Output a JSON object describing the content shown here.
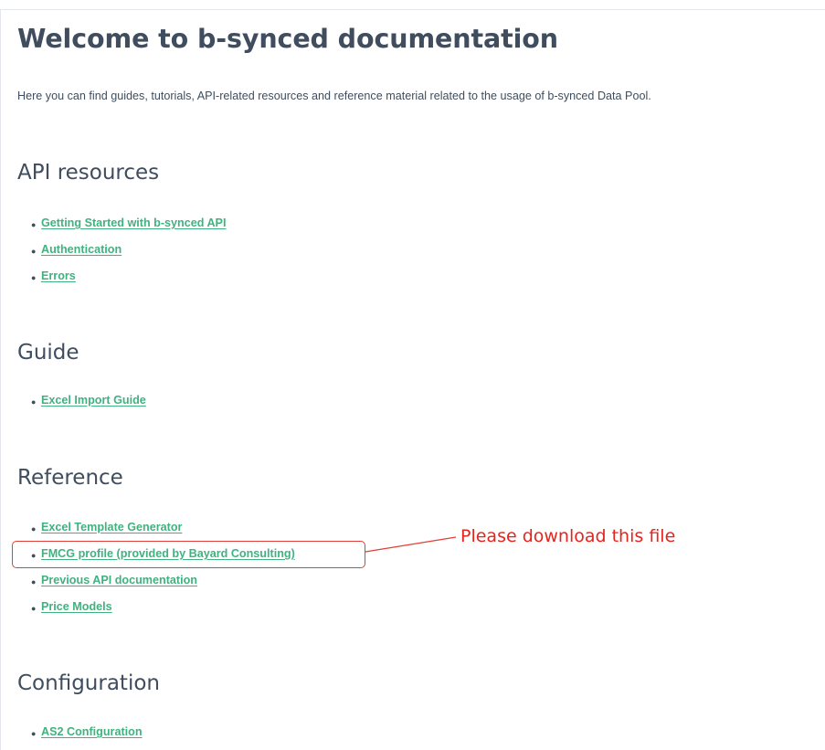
{
  "page": {
    "title": "Welcome to b-synced documentation",
    "intro": "Here you can find guides, tutorials, API-related resources and reference material related to the usage of b-synced Data Pool."
  },
  "sections": [
    {
      "heading": "API resources",
      "links": [
        "Getting Started with b-synced API",
        "Authentication",
        "Errors"
      ]
    },
    {
      "heading": "Guide",
      "links": [
        "Excel Import Guide"
      ]
    },
    {
      "heading": "Reference",
      "links": [
        "Excel Template Generator",
        "FMCG profile (provided by Bayard Consulting)",
        "Previous API documentation",
        "Price Models"
      ]
    },
    {
      "heading": "Configuration",
      "links": [
        "AS2 Configuration"
      ]
    }
  ],
  "annotation": {
    "text": "Please download this file",
    "color": "#e8231c"
  },
  "colors": {
    "heading": "#3f4d5e",
    "link": "#3fb27f",
    "annotation": "#e8231c"
  }
}
